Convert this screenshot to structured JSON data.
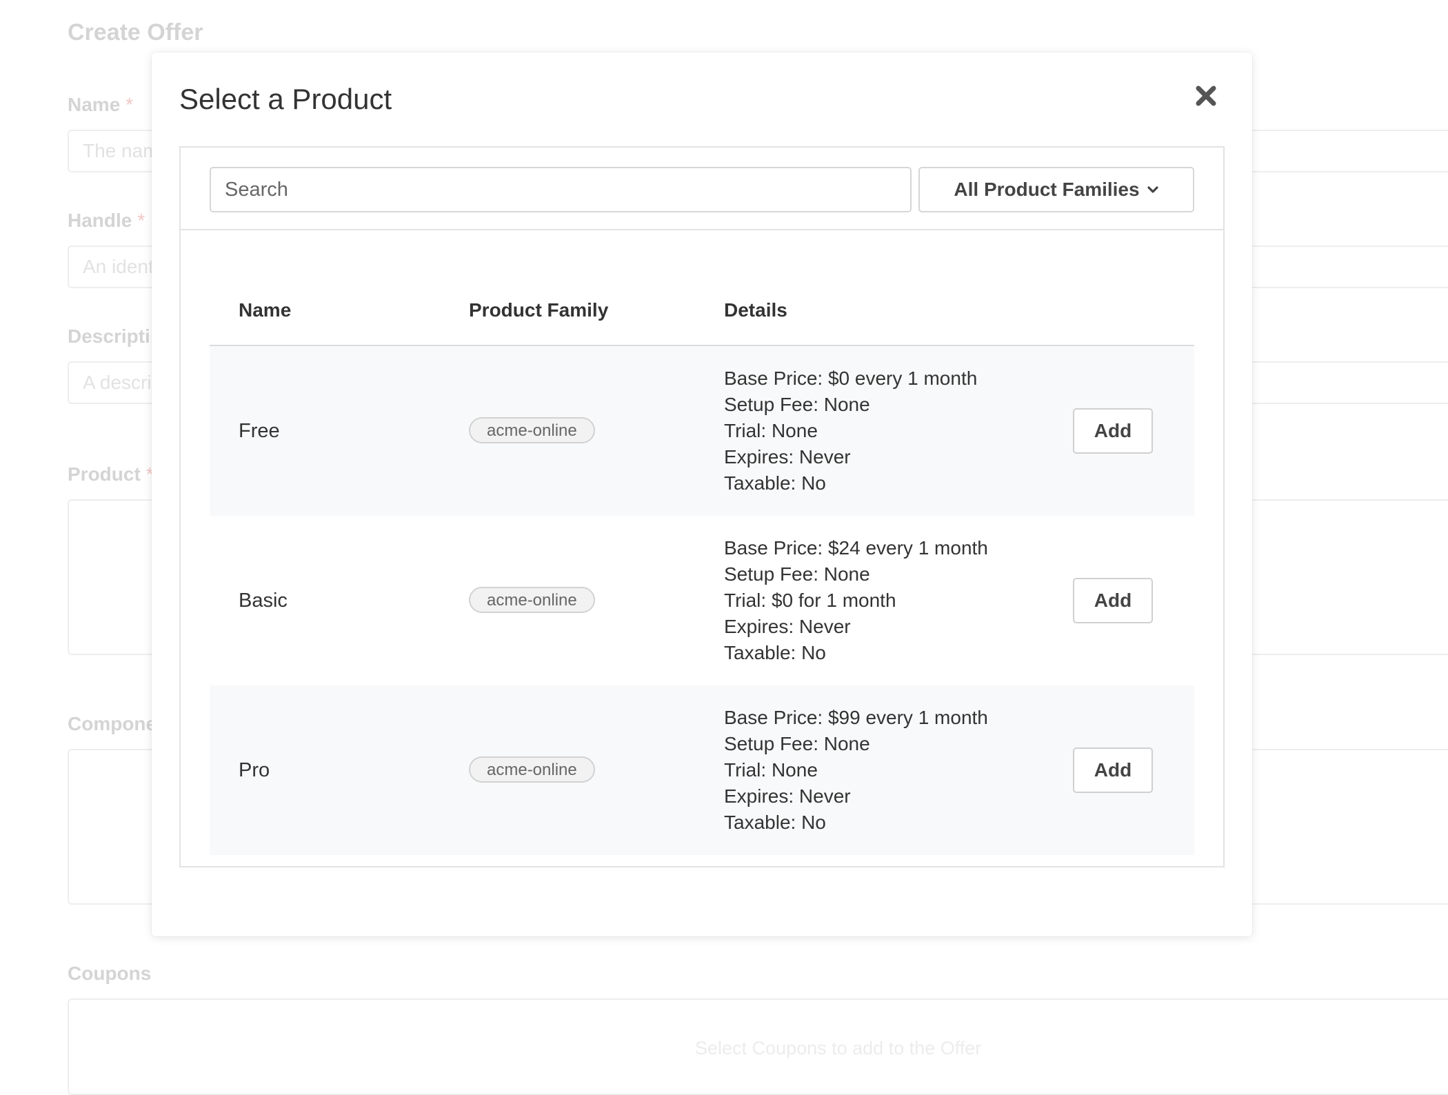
{
  "background": {
    "page_title": "Create Offer",
    "fields": {
      "name": {
        "label": "Name",
        "required_mark": "*",
        "placeholder": "The nam"
      },
      "handle": {
        "label": "Handle",
        "required_mark": "*",
        "placeholder": "An ident"
      },
      "description": {
        "label": "Descripti",
        "placeholder": "A descri"
      },
      "product": {
        "label": "Product",
        "required_mark": "*"
      },
      "components": {
        "label": "Compone"
      },
      "coupons": {
        "label": "Coupons",
        "hint": "Select Coupons to add to the Offer"
      }
    }
  },
  "modal": {
    "title": "Select a Product",
    "close_icon": "close-icon",
    "search": {
      "placeholder": "Search",
      "value": ""
    },
    "family_filter": {
      "label": "All Product Families",
      "icon": "chevron-down-icon"
    },
    "table": {
      "columns": [
        "Name",
        "Product Family",
        "Details"
      ],
      "rows": [
        {
          "name": "Free",
          "family": "acme-online",
          "details": [
            "Base Price: $0 every 1 month",
            "Setup Fee: None",
            "Trial: None",
            "Expires: Never",
            "Taxable: No"
          ],
          "action": "Add"
        },
        {
          "name": "Basic",
          "family": "acme-online",
          "details": [
            "Base Price: $24 every 1 month",
            "Setup Fee: None",
            "Trial: $0 for 1 month",
            "Expires: Never",
            "Taxable: No"
          ],
          "action": "Add"
        },
        {
          "name": "Pro",
          "family": "acme-online",
          "details": [
            "Base Price: $99 every 1 month",
            "Setup Fee: None",
            "Trial: None",
            "Expires: Never",
            "Taxable: No"
          ],
          "action": "Add"
        }
      ]
    }
  }
}
